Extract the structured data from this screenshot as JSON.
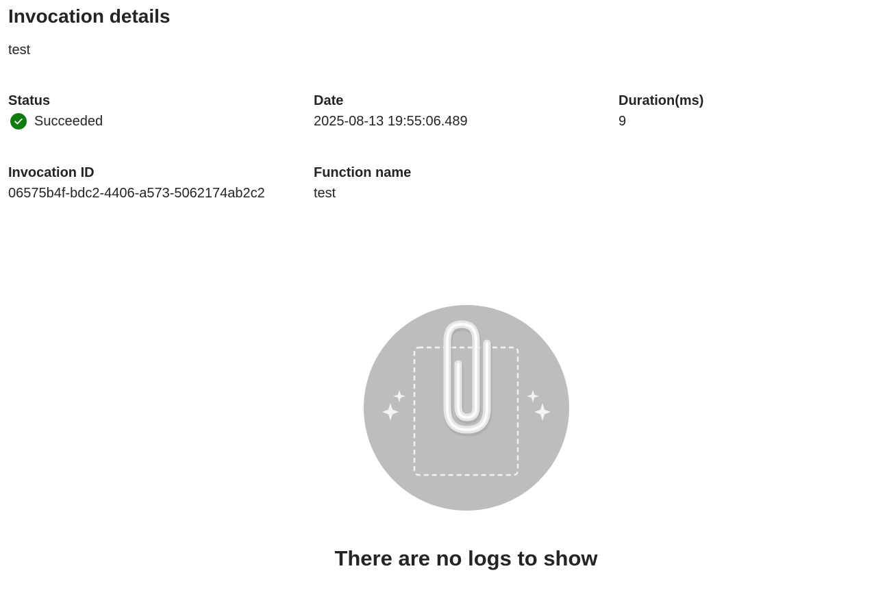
{
  "header": {
    "title": "Invocation details",
    "subtitle": "test"
  },
  "details": {
    "status": {
      "label": "Status",
      "value": "Succeeded",
      "icon": "check-circle-icon",
      "color": "#107c10"
    },
    "date": {
      "label": "Date",
      "value": "2025-08-13 19:55:06.489"
    },
    "duration": {
      "label": "Duration(ms)",
      "value": "9"
    },
    "invocation_id": {
      "label": "Invocation ID",
      "value": "06575b4f-bdc2-4406-a573-5062174ab2c2"
    },
    "function_name": {
      "label": "Function name",
      "value": "test"
    }
  },
  "logs": {
    "empty_message": "There are no logs to show",
    "illustration": "paperclip-icon",
    "circle_color": "#bdbdbd"
  }
}
